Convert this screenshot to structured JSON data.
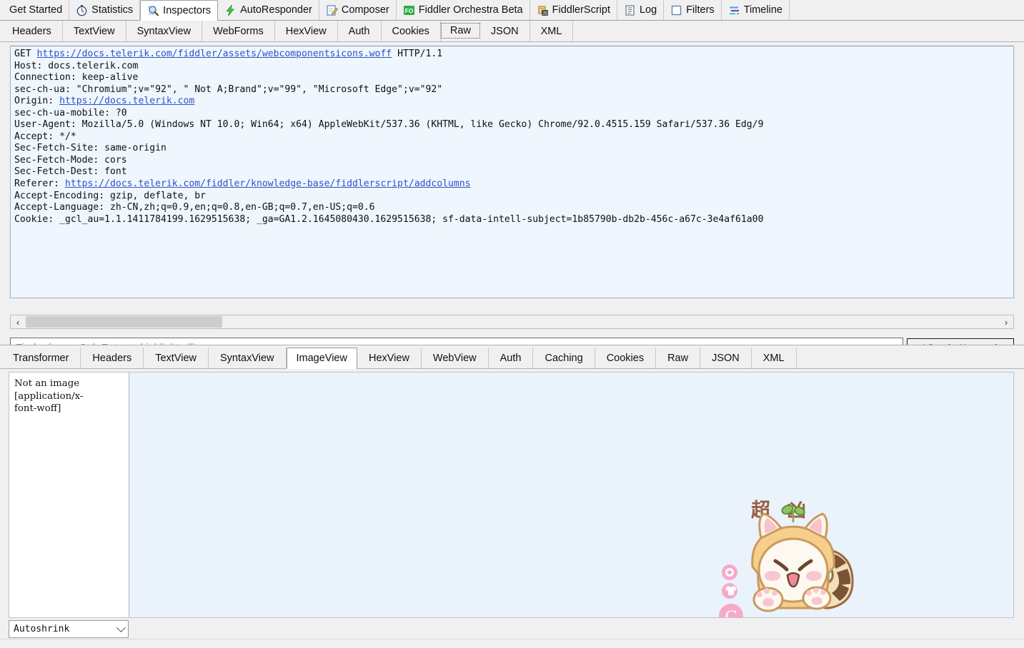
{
  "app": "Fiddler Web Debugger",
  "main_tabs": [
    {
      "label": "Get Started",
      "icon": "",
      "selected": false
    },
    {
      "label": "Statistics",
      "icon": "stopwatch-icon",
      "selected": false
    },
    {
      "label": "Inspectors",
      "icon": "magnifier-icon",
      "selected": true
    },
    {
      "label": "AutoResponder",
      "icon": "lightning-icon",
      "selected": false
    },
    {
      "label": "Composer",
      "icon": "notepad-pencil-icon",
      "selected": false
    },
    {
      "label": "Fiddler Orchestra Beta",
      "icon": "fo-badge-icon",
      "selected": false
    },
    {
      "label": "FiddlerScript",
      "icon": "script-js-icon",
      "selected": false
    },
    {
      "label": "Log",
      "icon": "log-lines-icon",
      "selected": false
    },
    {
      "label": "Filters",
      "icon": "filter-square-icon",
      "selected": false
    },
    {
      "label": "Timeline",
      "icon": "timeline-bars-icon",
      "selected": false
    }
  ],
  "request": {
    "tabs": [
      {
        "label": "Headers",
        "selected": false
      },
      {
        "label": "TextView",
        "selected": false
      },
      {
        "label": "SyntaxView",
        "selected": false
      },
      {
        "label": "WebForms",
        "selected": false
      },
      {
        "label": "HexView",
        "selected": false
      },
      {
        "label": "Auth",
        "selected": false
      },
      {
        "label": "Cookies",
        "selected": false
      },
      {
        "label": "Raw",
        "selected": true
      },
      {
        "label": "JSON",
        "selected": false
      },
      {
        "label": "XML",
        "selected": false
      }
    ],
    "raw_lines": [
      {
        "text": "GET ",
        "link": "https://docs.telerik.com/fiddler/assets/webcomponentsicons.woff",
        "after": " HTTP/1.1"
      },
      {
        "text": "Host: docs.telerik.com"
      },
      {
        "text": "Connection: keep-alive"
      },
      {
        "text": "sec-ch-ua: \"Chromium\";v=\"92\", \" Not A;Brand\";v=\"99\", \"Microsoft Edge\";v=\"92\""
      },
      {
        "text": "Origin: ",
        "link": "https://docs.telerik.com",
        "after": ""
      },
      {
        "text": "sec-ch-ua-mobile: ?0"
      },
      {
        "text": "User-Agent: Mozilla/5.0 (Windows NT 10.0; Win64; x64) AppleWebKit/537.36 (KHTML, like Gecko) Chrome/92.0.4515.159 Safari/537.36 Edg/9"
      },
      {
        "text": "Accept: */*"
      },
      {
        "text": "Sec-Fetch-Site: same-origin"
      },
      {
        "text": "Sec-Fetch-Mode: cors"
      },
      {
        "text": "Sec-Fetch-Dest: font"
      },
      {
        "text": "Referer: ",
        "link": "https://docs.telerik.com/fiddler/knowledge-base/fiddlerscript/addcolumns",
        "after": ""
      },
      {
        "text": "Accept-Encoding: gzip, deflate, br"
      },
      {
        "text": "Accept-Language: zh-CN,zh;q=0.9,en;q=0.8,en-GB;q=0.7,en-US;q=0.6"
      },
      {
        "text": "Cookie: _gcl_au=1.1.1411784199.1629515638; _ga=GA1.2.1645080430.1629515638; sf-data-intell-subject=1b85790b-db2b-456c-a67c-3e4af61a00"
      }
    ],
    "scroll_left_arrow": "‹",
    "scroll_right_arrow": "›",
    "find_placeholder": "Find... (press Ctrl+Enter to highlight all)",
    "find_value": "",
    "view_notepad_label": "View in Notepad"
  },
  "response": {
    "tabs": [
      {
        "label": "Transformer",
        "selected": false
      },
      {
        "label": "Headers",
        "selected": false
      },
      {
        "label": "TextView",
        "selected": false
      },
      {
        "label": "SyntaxView",
        "selected": false
      },
      {
        "label": "ImageView",
        "selected": true
      },
      {
        "label": "HexView",
        "selected": false
      },
      {
        "label": "WebView",
        "selected": false
      },
      {
        "label": "Auth",
        "selected": false
      },
      {
        "label": "Caching",
        "selected": false
      },
      {
        "label": "Cookies",
        "selected": false
      },
      {
        "label": "Raw",
        "selected": false
      },
      {
        "label": "JSON",
        "selected": false
      },
      {
        "label": "XML",
        "selected": false
      }
    ],
    "not_an_image_text": "Not an image\n[application/x-\nfont-woff]",
    "shrink_mode": "Autoshrink",
    "sticker": {
      "char_left": "超",
      "char_right": "凶",
      "badge_letter": "C"
    }
  },
  "colors": {
    "raw_background": "#eff6fe",
    "link": "#2d52c8",
    "imageview_background": "#eaf2fb",
    "chrome": "#f0f0f0",
    "sticker_pink": "#f8a8c8",
    "sticker_orange": "#f6c87a",
    "sticker_brown": "#8a5a3c"
  }
}
